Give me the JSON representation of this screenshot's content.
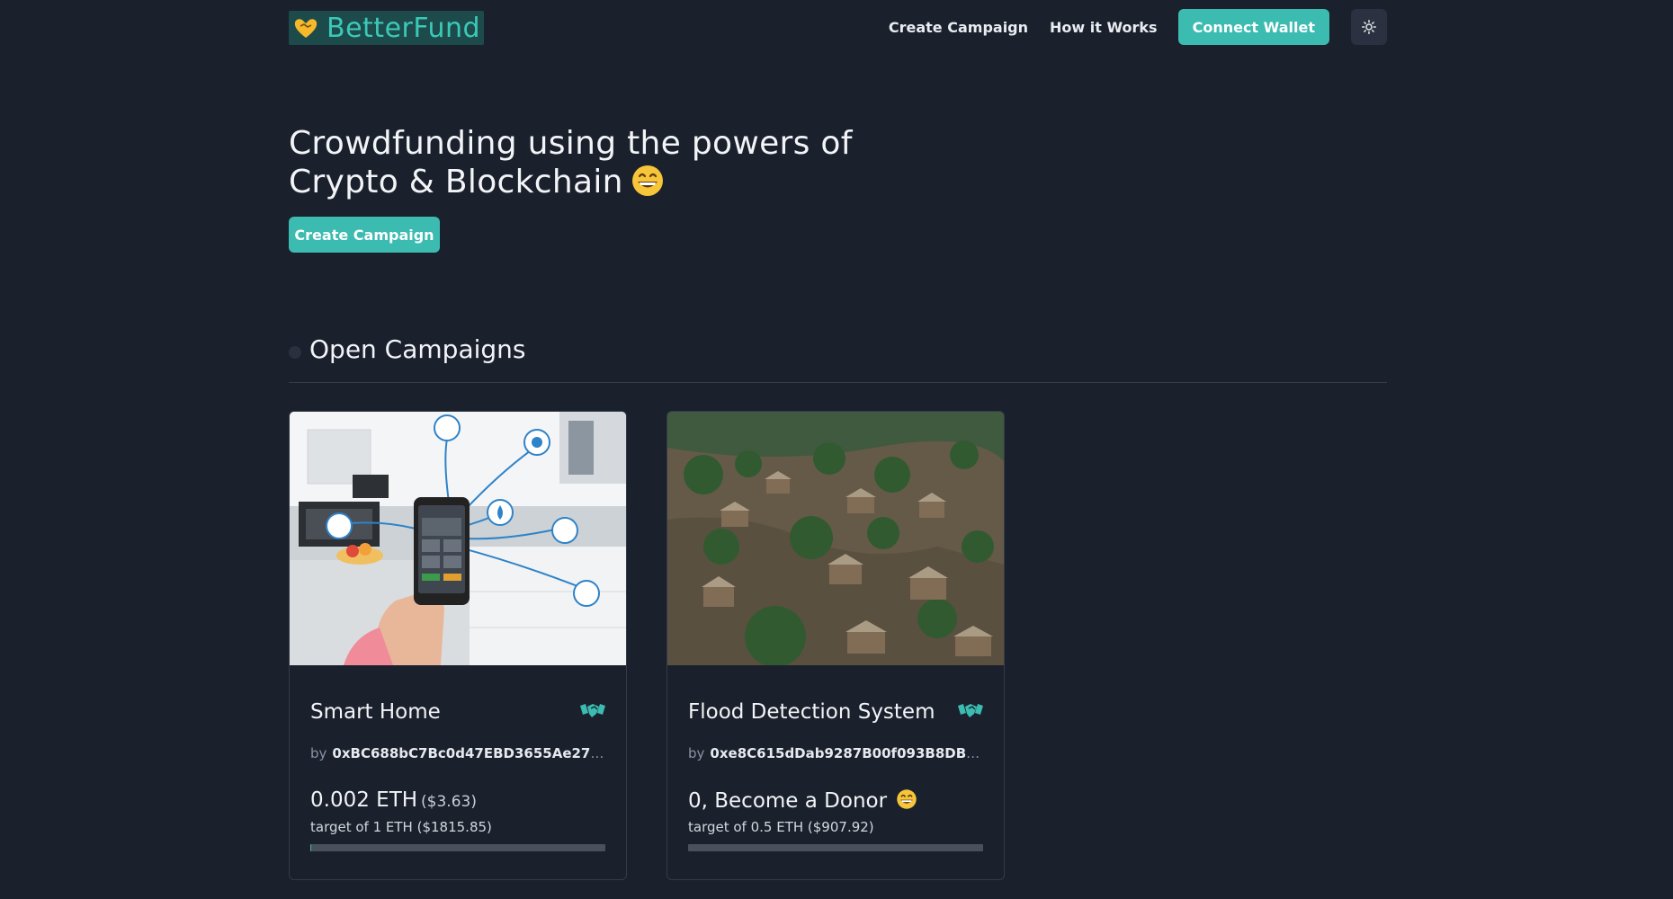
{
  "header": {
    "logo_text": "BetterFund",
    "nav": [
      {
        "label": "Create Campaign"
      },
      {
        "label": "How it Works"
      }
    ],
    "connect_wallet_label": "Connect Wallet"
  },
  "hero": {
    "title_line1": "Crowdfunding using the powers of",
    "title_line2": "Crypto & Blockchain",
    "cta_label": "Create Campaign"
  },
  "section": {
    "title": "Open Campaigns"
  },
  "campaigns": [
    {
      "title": "Smart Home",
      "by_label": "by",
      "address": "0xBC688bC7Bc0d47EBD3655Ae27b...",
      "amount": "0.002 ETH",
      "amount_usd": "($3.63)",
      "target": "target of 1 ETH ($1815.85)",
      "progress": 0.002
    },
    {
      "title": "Flood Detection System",
      "by_label": "by",
      "address": "0xe8C615dDab9287B00f093B8DBD...",
      "amount": "0, Become a Donor",
      "amount_usd": "",
      "target": "target of 0.5 ETH ($907.92)",
      "progress": 0
    }
  ],
  "colors": {
    "background": "#1a202c",
    "accent": "#3cbbb1",
    "logo_text": "#3cc8b8"
  }
}
